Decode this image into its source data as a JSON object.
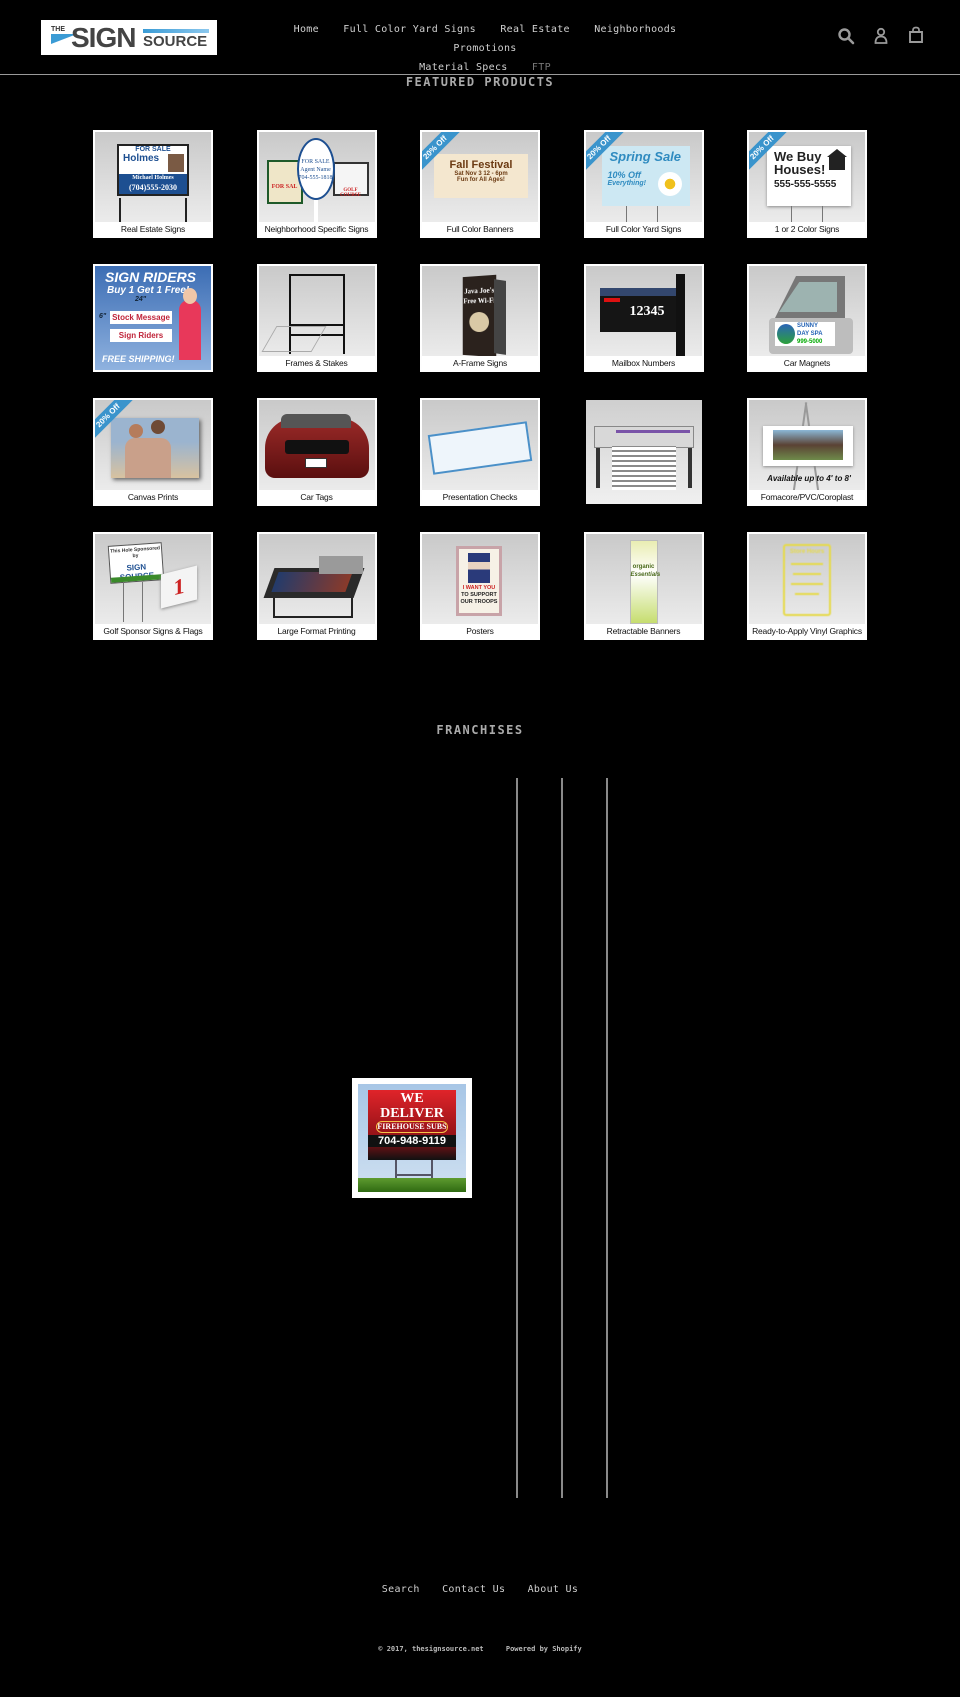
{
  "header": {
    "logo": {
      "the": "THE",
      "sign": "SIGN",
      "source": "SOURCE",
      "alt": "The Sign Source"
    },
    "nav": [
      {
        "label": "Home"
      },
      {
        "label": "Full Color Yard Signs"
      },
      {
        "label": "Real Estate"
      },
      {
        "label": "Neighborhoods"
      },
      {
        "label": "Promotions"
      },
      {
        "label": "Material Specs"
      },
      {
        "label": "FTP"
      }
    ],
    "icons": {
      "search": "search-icon",
      "account": "account-icon",
      "cart": "cart-icon"
    }
  },
  "featured": {
    "title": "FEATURED PRODUCTS",
    "products": [
      {
        "label": "Real Estate Signs",
        "ribbon": "",
        "art": "real-estate"
      },
      {
        "label": "Neighborhood Specific Signs",
        "ribbon": "",
        "art": "neighborhood"
      },
      {
        "label": "Full Color Banners",
        "ribbon": "20% Off",
        "art": "banner"
      },
      {
        "label": "Full Color Yard Signs",
        "ribbon": "20% Off",
        "art": "yard"
      },
      {
        "label": "1 or 2  Color Signs",
        "ribbon": "20% Off",
        "art": "houses"
      },
      {
        "label": "",
        "ribbon": "",
        "art": "riders"
      },
      {
        "label": "Frames & Stakes",
        "ribbon": "",
        "art": "frames"
      },
      {
        "label": "A-Frame Signs",
        "ribbon": "",
        "art": "aframe"
      },
      {
        "label": "Mailbox Numbers",
        "ribbon": "",
        "art": "mailbox"
      },
      {
        "label": "Car Magnets",
        "ribbon": "",
        "art": "magnet"
      },
      {
        "label": "Canvas Prints",
        "ribbon": "20% Off",
        "art": "canvas"
      },
      {
        "label": "Car Tags",
        "ribbon": "",
        "art": "car"
      },
      {
        "label": "Presentation Checks",
        "ribbon": "",
        "art": "check"
      },
      {
        "label": "",
        "ribbon": "",
        "art": "printer"
      },
      {
        "label": "Fomacore/PVC/Coroplast",
        "ribbon": "",
        "art": "foam"
      },
      {
        "label": "Golf Sponsor Signs & Flags",
        "ribbon": "",
        "art": "golf"
      },
      {
        "label": "Large Format Printing",
        "ribbon": "",
        "art": "flatbed"
      },
      {
        "label": "Posters",
        "ribbon": "",
        "art": "poster"
      },
      {
        "label": "Retractable Banners",
        "ribbon": "",
        "art": "retract"
      },
      {
        "label": "Ready-to-Apply Vinyl Graphics",
        "ribbon": "",
        "art": "vinyl"
      }
    ],
    "art_text": {
      "real_estate": {
        "top": "FOR SALE",
        "brand": "Holmes",
        "name": "Michael Holmes",
        "phone": "(704)555-2030"
      },
      "neighborhood": {
        "oval1": "FOR SALE",
        "oval2": "Agent Name",
        "oval3": "704-555-1818",
        "left": "FOR SAL",
        "right": "GOLF COURSE"
      },
      "banner": {
        "l1": "Fall Festival",
        "l2": "Sat Nov 3  12 - 6pm",
        "l3": "Fun for All Ages!"
      },
      "yard": {
        "l1": "Spring Sale",
        "l2": "10% Off",
        "l3": "Everything!"
      },
      "houses": {
        "l1": "We Buy",
        "l2": "Houses!",
        "l3": "555-555-5555"
      },
      "riders": {
        "l1": "SIGN RIDERS",
        "l2": "Buy 1 Get 1 Free!",
        "w": "24\"",
        "h": "6\"",
        "b1": "Stock Message",
        "b2": "Sign Riders",
        "l3": "FREE SHIPPING!"
      },
      "aframe": {
        "l1": "Java Joe's",
        "l2": "Free Wi-Fi"
      },
      "mailbox": {
        "num": "12345"
      },
      "magnet": {
        "l1": "SUNNY",
        "l2": "DAY SPA",
        "l3": "999-5000"
      },
      "foam": {
        "l1": "Available up to 4' to 8'"
      },
      "golf": {
        "l1": "This Hole Sponsored by",
        "l2": "SIGN SOURCE",
        "flag": "1"
      },
      "poster": {
        "l1": "I WANT YOU",
        "l2": "TO SUPPORT",
        "l3": "OUR TROOPS"
      },
      "retract": {
        "l1": "organic",
        "l2": "Essentials"
      },
      "vinyl": {
        "l1": "Store Hours"
      }
    }
  },
  "franchises": {
    "title": "FRANCHISES",
    "sign": {
      "l1": "WE",
      "l2": "DELIVER",
      "brand": "FIREHOUSE SUBS",
      "phone": "704-948-9119"
    }
  },
  "footer": {
    "links": [
      {
        "label": "Search"
      },
      {
        "label": "Contact Us"
      },
      {
        "label": "About Us"
      }
    ],
    "copyright": "© 2017, thesignsource.net",
    "powered": "Powered by Shopify"
  },
  "colors": {
    "background": "#000000",
    "accent_ribbon": "#3a94cc",
    "divider": "#9a9a9a"
  }
}
